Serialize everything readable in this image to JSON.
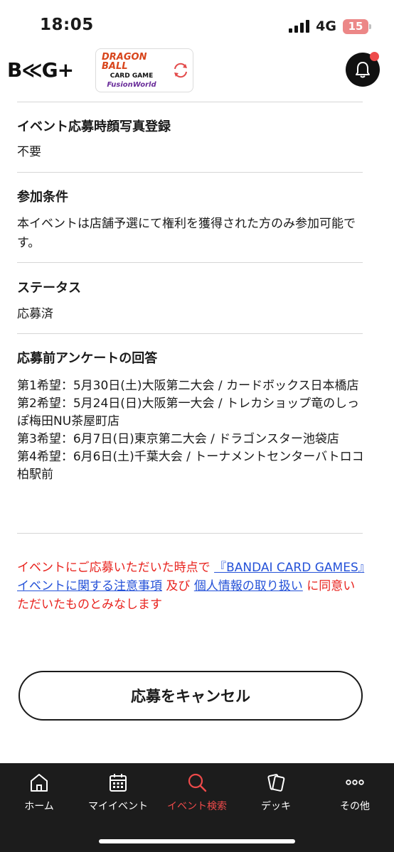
{
  "status_bar": {
    "time": "18:05",
    "network": "4G",
    "battery": "15"
  },
  "header": {
    "logo_text": "B≪G+",
    "card_logo": {
      "line1": "DRAGON BALL",
      "line2": "CARD GAME",
      "line3": "FusionWorld"
    },
    "notification_icon": "bell-icon",
    "notification_dot_color": "#ee4a4a"
  },
  "sections": {
    "photo": {
      "title": "イベント応募時顔写真登録",
      "value": "不要"
    },
    "condition": {
      "title": "参加条件",
      "value": "本イベントは店舗予選にて権利を獲得された方のみ参加可能です。"
    },
    "status": {
      "title": "ステータス",
      "value": "応募済"
    },
    "survey": {
      "title": "応募前アンケートの回答",
      "answers": [
        "第1希望：5月30日(土)大阪第二大会 / カードボックス日本橋店",
        "第2希望：5月24日(日)大阪第一大会 / トレカショップ竜のしっぽ梅田NU茶屋町店",
        "第3希望：6月7日(日)東京第二大会 / ドラゴンスター池袋店",
        "第4希望：6月6日(土)千葉大会 / トーナメントセンターバトロコ柏駅前"
      ]
    }
  },
  "notice": {
    "part1": "イベントにご応募いただいた時点で",
    "link1": "『BANDAI CARD GAMES』イベントに関する注意事項",
    "part2": "及び",
    "link2": "個人情報の取り扱い",
    "part3": "に同意いただいたものとみなします",
    "text_color": "#e8231e",
    "link_color": "#2552d8"
  },
  "cancel_button": {
    "label": "応募をキャンセル"
  },
  "bottom_nav": {
    "items": [
      {
        "label": "ホーム",
        "icon": "home-icon"
      },
      {
        "label": "マイイベント",
        "icon": "calendar-icon"
      },
      {
        "label": "イベント検索",
        "icon": "search-icon",
        "active": true
      },
      {
        "label": "デッキ",
        "icon": "cards-icon"
      },
      {
        "label": "その他",
        "icon": "more-icon"
      }
    ],
    "active_color": "#ee4a4a"
  }
}
